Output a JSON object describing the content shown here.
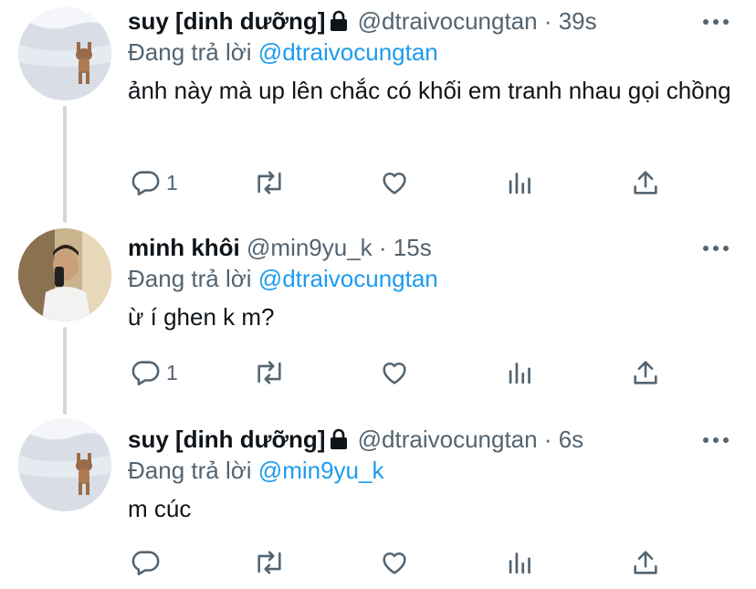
{
  "tweets": [
    {
      "name": "suy [dinh dưỡng]",
      "handle": "@dtraivocungtan",
      "time": "· 39s",
      "reply_prefix": "Đang trả lời",
      "reply_to": "@dtraivocungtan",
      "text": "ảnh này mà up lên chắc có khối em tranh nhau gọi chồng",
      "reply_count": "1",
      "locked": true
    },
    {
      "name": "minh khôi",
      "handle": "@min9yu_k",
      "time": "· 15s",
      "reply_prefix": "Đang trả lời",
      "reply_to": "@dtraivocungtan",
      "text": "ừ í ghen k m?",
      "reply_count": "1",
      "locked": false
    },
    {
      "name": "suy [dinh dưỡng]",
      "handle": "@dtraivocungtan",
      "time": "· 6s",
      "reply_prefix": "Đang trả lời",
      "reply_to": "@min9yu_k",
      "text": "m cúc",
      "reply_count": "",
      "locked": true
    }
  ],
  "icons": {
    "reply": "reply-icon",
    "retweet": "retweet-icon",
    "like": "heart-icon",
    "analytics": "analytics-icon",
    "share": "share-icon",
    "more": "more-icon",
    "lock": "lock-icon"
  },
  "colors": {
    "text": "#0f1419",
    "secondary": "#536471",
    "link": "#1d9bf0",
    "thread_line": "#cfd9de"
  }
}
